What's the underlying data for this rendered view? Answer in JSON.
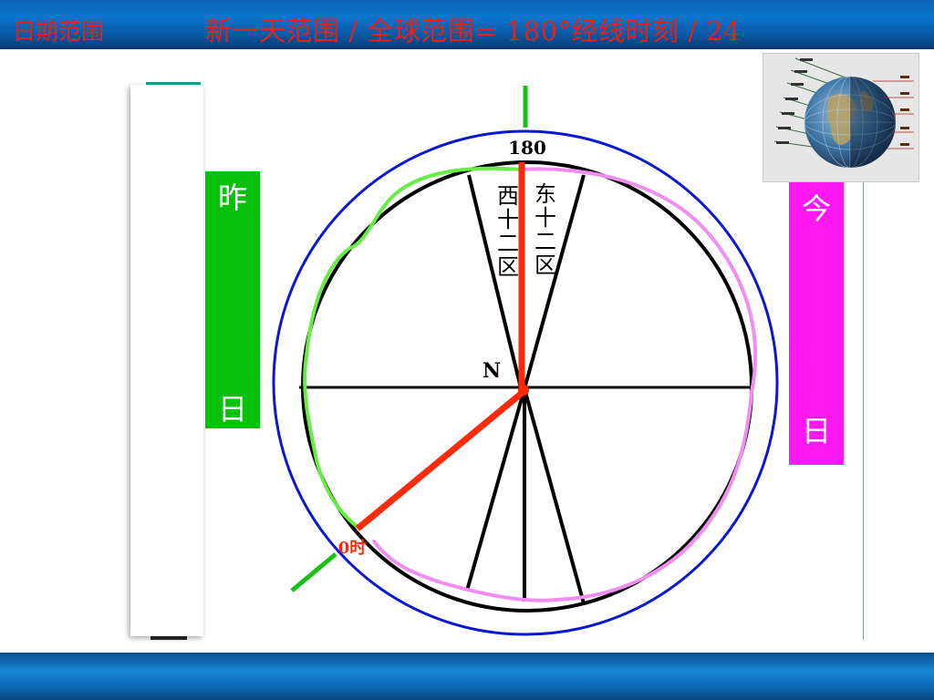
{
  "header": {
    "left_label": "日期范围",
    "title": "新一天范围 / 全球范围= 180°经线时刻 / 24"
  },
  "diagram": {
    "meridian_label": "180",
    "west_zone_label": [
      "西",
      "十",
      "二",
      "区"
    ],
    "east_zone_label": [
      "东",
      "十",
      "二",
      "区"
    ],
    "pole_label": "N",
    "midnight_label": "0时"
  },
  "left_bar": {
    "top_char": "昨",
    "bottom_char": "日",
    "color": "#06c10a"
  },
  "right_bar": {
    "top_char": "今",
    "bottom_char": "日",
    "color": "#ff18f0"
  },
  "colors": {
    "header_text": "#e8201a",
    "outer_circle": "#0a18d0",
    "inner_circle": "#000000",
    "red_line": "#ff2a0a",
    "green_line": "#18c018",
    "yesterday_outline": "#66ee44",
    "today_outline": "#f08ef0"
  },
  "icons": {
    "globe_thumbnail": "globe-icon"
  }
}
